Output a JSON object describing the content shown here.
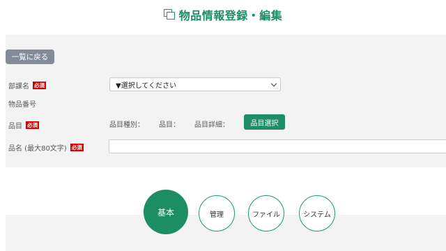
{
  "header": {
    "title": "物品情報登録・編集",
    "icon": "copy-icon"
  },
  "actions": {
    "back_label": "一覧に戻る"
  },
  "form": {
    "required_badge": "必須",
    "department_label": "部課名",
    "department_select_value": "▼選択してください",
    "item_number_label": "物品番号",
    "category_label": "品目",
    "category_type_label": "品目種別：",
    "category_value_label": "品目：",
    "category_detail_label": "品目詳細：",
    "category_select_button": "品目選択",
    "name_label": "品名 (最大80文字)",
    "name_value": ""
  },
  "tabs": [
    "基本",
    "管理",
    "ファイル",
    "システム"
  ],
  "colors": {
    "accent": "#1c8d64",
    "required": "#d40000",
    "back_button": "#858b96"
  }
}
